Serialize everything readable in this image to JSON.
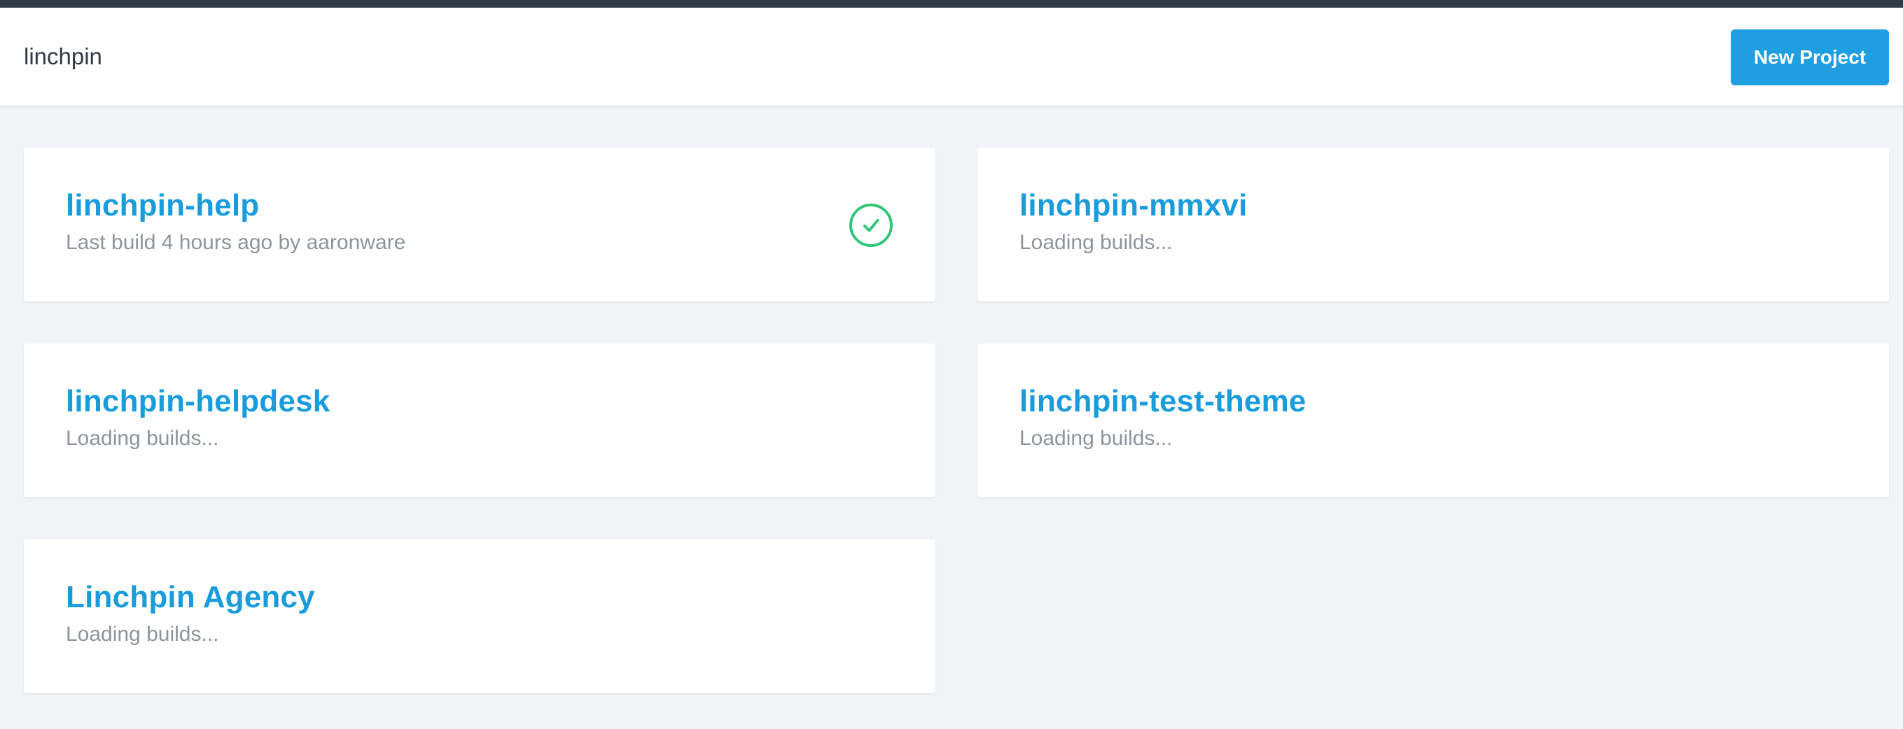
{
  "header": {
    "org_name": "linchpin",
    "new_project_label": "New Project"
  },
  "colors": {
    "accent": "#1f9fe1",
    "title": "#1a9cdc",
    "success": "#34c57a",
    "top_strip": "#323a45",
    "background": "#f1f3f6"
  },
  "projects": [
    {
      "name": "linchpin-help",
      "status_text": "Last build 4 hours ago by aaronware",
      "status_icon": "check-circle-icon"
    },
    {
      "name": "linchpin-mmxvi",
      "status_text": "Loading builds..."
    },
    {
      "name": "linchpin-helpdesk",
      "status_text": "Loading builds..."
    },
    {
      "name": "linchpin-test-theme",
      "status_text": "Loading builds..."
    },
    {
      "name": "Linchpin Agency",
      "status_text": "Loading builds..."
    }
  ]
}
